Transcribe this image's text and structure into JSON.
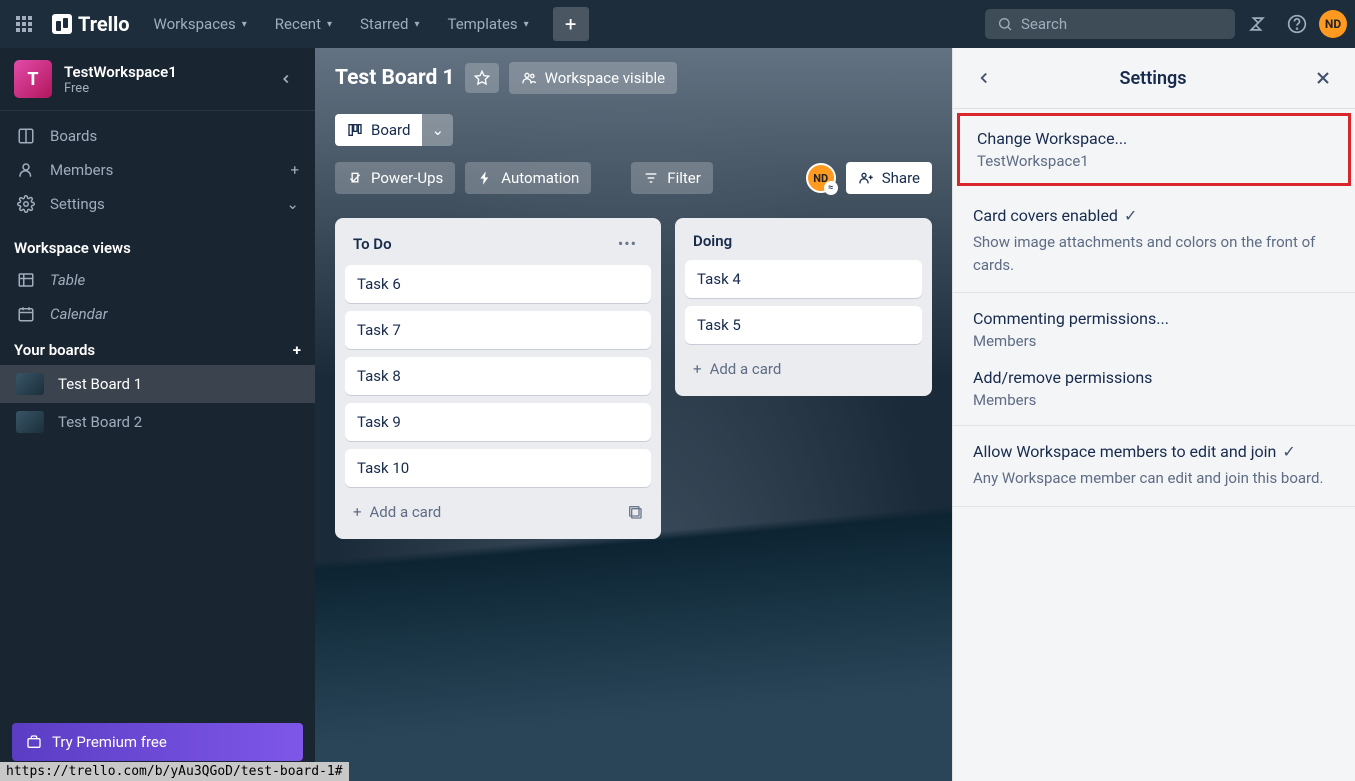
{
  "topnav": {
    "logo": "Trello",
    "items": [
      "Workspaces",
      "Recent",
      "Starred",
      "Templates"
    ],
    "search_placeholder": "Search",
    "avatar": "ND"
  },
  "sidebar": {
    "workspace": {
      "badge": "T",
      "name": "TestWorkspace1",
      "plan": "Free"
    },
    "nav": {
      "boards": "Boards",
      "members": "Members",
      "settings": "Settings"
    },
    "views_heading": "Workspace views",
    "views": {
      "table": "Table",
      "calendar": "Calendar"
    },
    "boards_heading": "Your boards",
    "boards": [
      "Test Board 1",
      "Test Board 2"
    ],
    "premium": "Try Premium free"
  },
  "board": {
    "title": "Test Board 1",
    "visibility": "Workspace visible",
    "view_label": "Board",
    "powerups": "Power-Ups",
    "automation": "Automation",
    "filter": "Filter",
    "share": "Share",
    "avatar": "ND"
  },
  "lists": [
    {
      "title": "To Do",
      "cards": [
        "Task 6",
        "Task 7",
        "Task 8",
        "Task 9",
        "Task 10"
      ],
      "add": "Add a card"
    },
    {
      "title": "Doing",
      "cards": [
        "Task 4",
        "Task 5"
      ],
      "add": "Add a card"
    }
  ],
  "settings": {
    "title": "Settings",
    "change_ws": {
      "title": "Change Workspace...",
      "value": "TestWorkspace1"
    },
    "covers": {
      "title": "Card covers enabled",
      "desc": "Show image attachments and colors on the front of cards."
    },
    "commenting": {
      "title": "Commenting permissions...",
      "value": "Members"
    },
    "addremove": {
      "title": "Add/remove permissions",
      "value": "Members"
    },
    "allow_edit": {
      "title": "Allow Workspace members to edit and join",
      "desc": "Any Workspace member can edit and join this board."
    }
  },
  "status_url": "https://trello.com/b/yAu3QGoD/test-board-1#"
}
